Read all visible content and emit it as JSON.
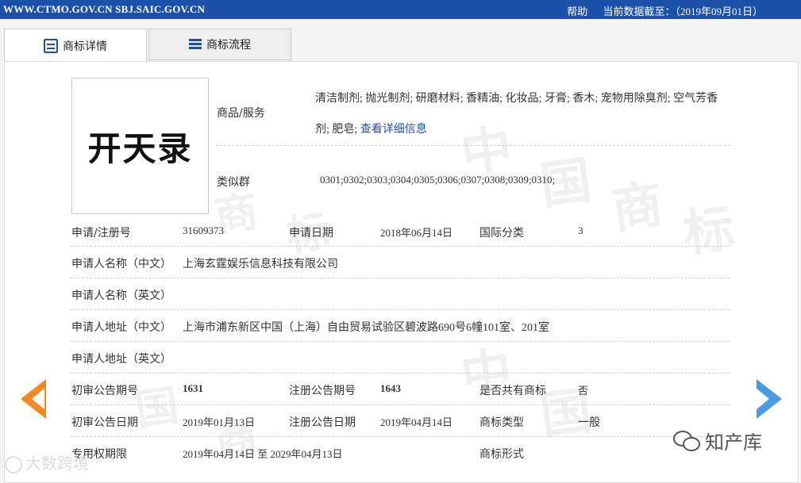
{
  "topbar": {
    "url": "WWW.CTMO.GOV.CN SBJ.SAIC.GOV.CN",
    "help": "帮助",
    "data_date": "当前数据截至：（2019年09月01日）"
  },
  "tabs": [
    {
      "label": "商标详情",
      "active": true,
      "icon": "document-icon"
    },
    {
      "label": "商标流程",
      "active": false,
      "icon": "list-icon"
    }
  ],
  "trademark": {
    "image_text": "开天录",
    "goods_label": "商品/服务",
    "goods_line1": "清洁制剂; 抛光制剂; 研磨材料; 香精油; 化妆品; 牙膏; 香木; 宠物用除臭剂; 空气芳香",
    "goods_line2": "剂; 肥皂; ",
    "goods_link": "查看详细信息",
    "similar_label": "类似群",
    "similar_value": "0301;0302;0303;0304;0305;0306;0307;0308;0309;0310;"
  },
  "fields": {
    "reg_no_label": "申请/注册号",
    "reg_no": "31609373",
    "app_date_label": "申请日期",
    "app_date": "2018年06月14日",
    "intl_class_label": "国际分类",
    "intl_class": "3",
    "applicant_cn_label": "申请人名称（中文）",
    "applicant_cn": "上海玄霆娱乐信息科技有限公司",
    "applicant_en_label": "申请人名称（英文）",
    "applicant_en": "",
    "address_cn_label": "申请人地址（中文）",
    "address_cn": "上海市浦东新区中国（上海）自由贸易试验区碧波路690号6幢101室、201室",
    "address_en_label": "申请人地址（英文）",
    "address_en": "",
    "prelim_no_label": "初审公告期号",
    "prelim_no": "1631",
    "reg_pub_no_label": "注册公告期号",
    "reg_pub_no": "1643",
    "shared_label": "是否共有商标",
    "shared": "否",
    "prelim_date_label": "初审公告日期",
    "prelim_date": "2019年01月13日",
    "reg_pub_date_label": "注册公告日期",
    "reg_pub_date": "2019年04月14日",
    "tm_type_label": "商标类型",
    "tm_type": "一般",
    "exclusive_label": "专用权期限",
    "exclusive": "2019年04月14日 至 2029年04月13日",
    "tm_form_label": "商标形式",
    "tm_form": ""
  },
  "overlay": {
    "wechat": "知产库",
    "source": "大数跨境"
  },
  "watermark": [
    "中",
    "国",
    "商",
    "标"
  ],
  "colors": {
    "brand": "#1d50a8",
    "prev": "#f08a24",
    "next": "#4a9be0"
  }
}
